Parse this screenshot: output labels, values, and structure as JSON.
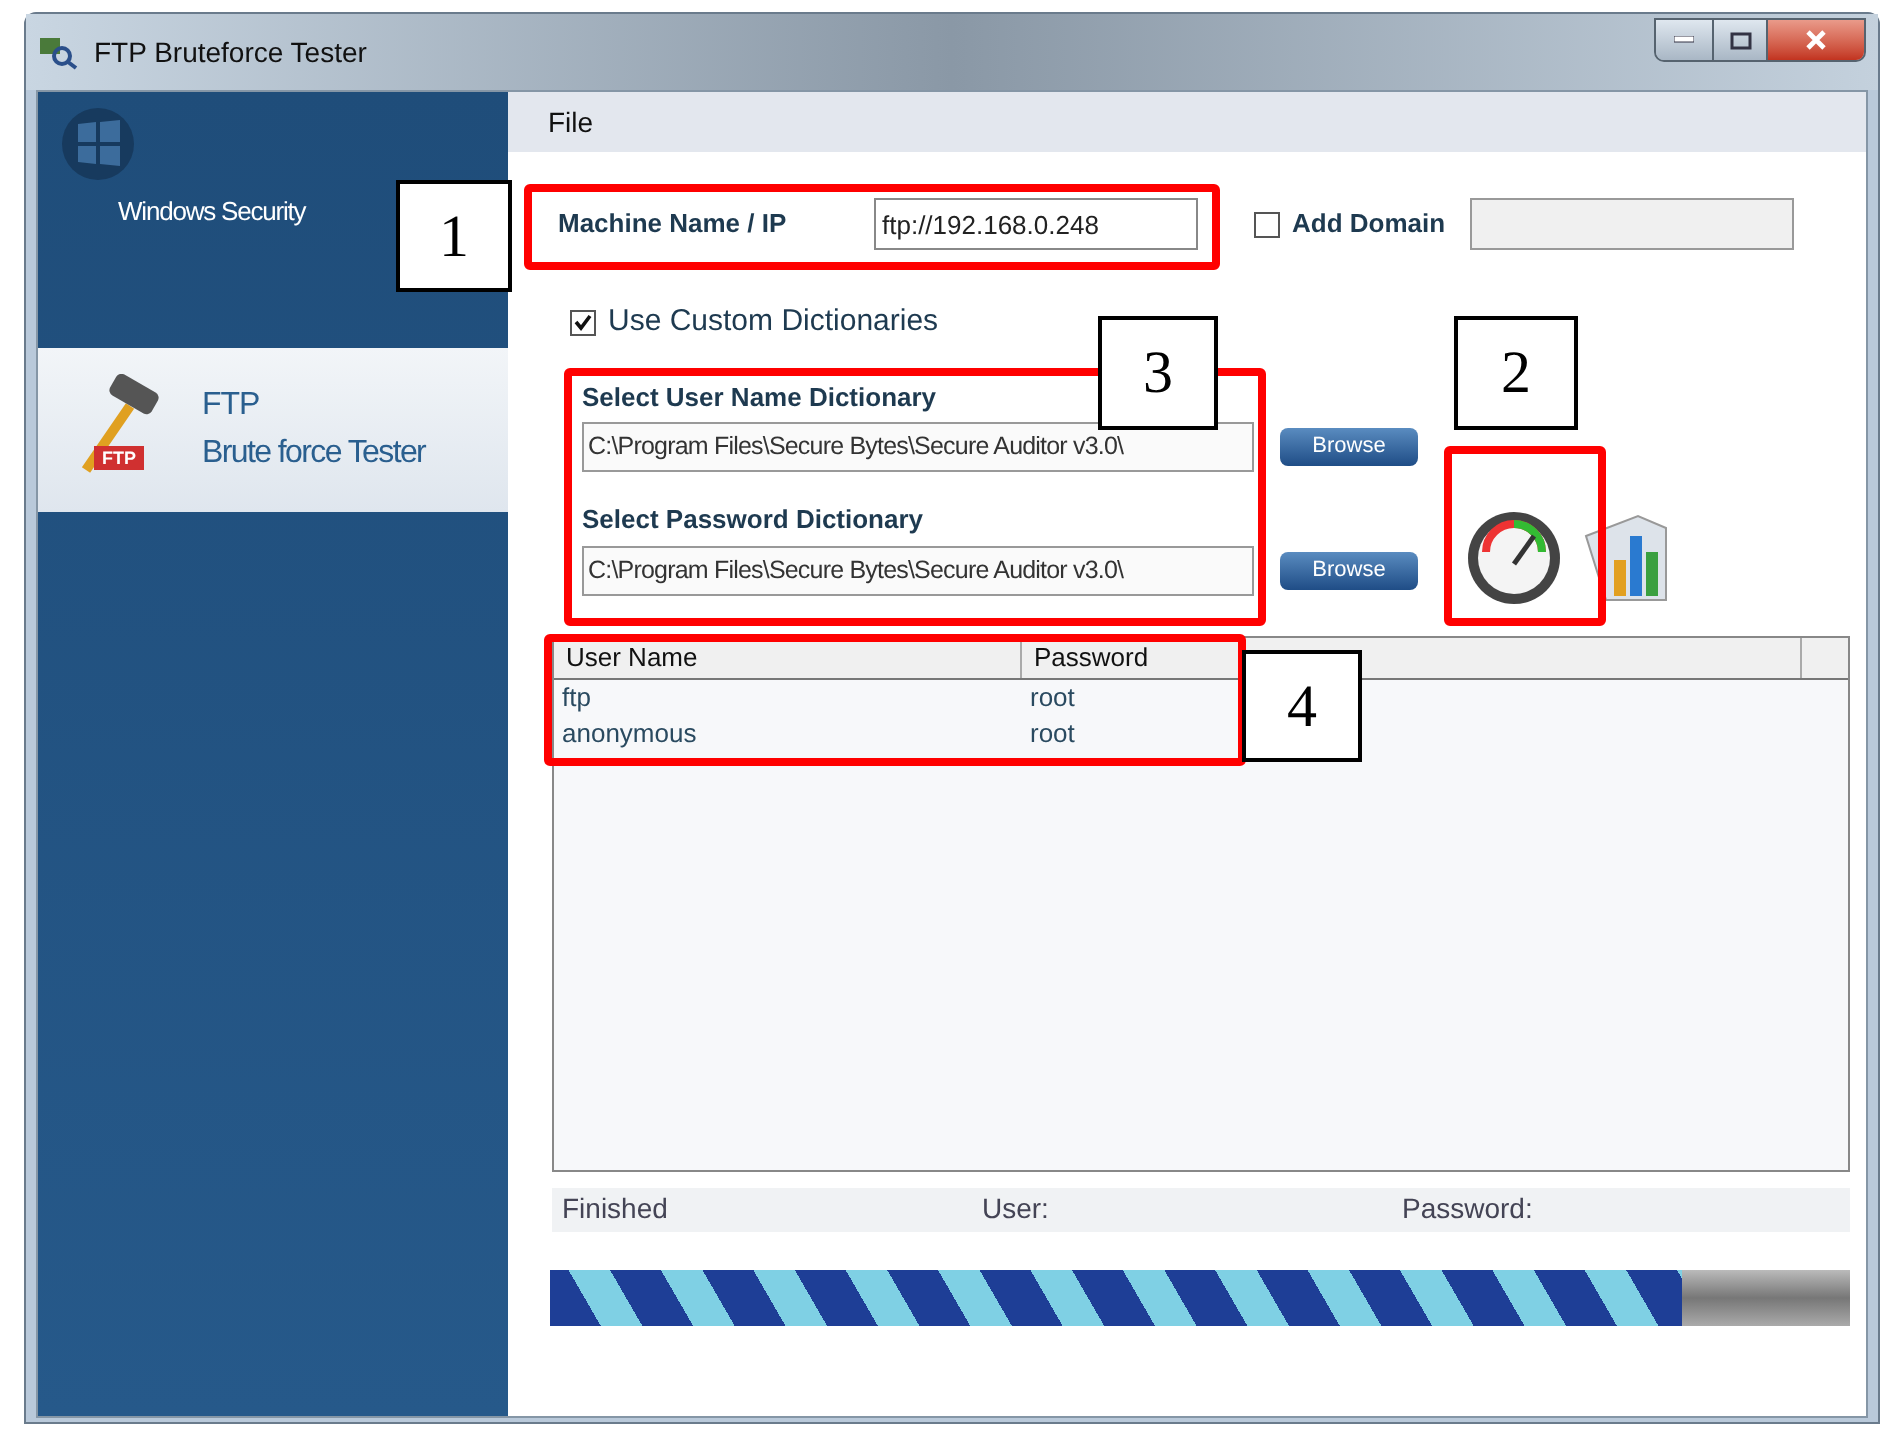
{
  "window": {
    "title": "FTP Bruteforce Tester"
  },
  "sidebar": {
    "brand": "Windows Security",
    "items": [
      {
        "title": "FTP",
        "subtitle": "Brute force Tester",
        "badge": "FTP",
        "selected": true
      }
    ]
  },
  "menu": [
    "File"
  ],
  "machine": {
    "label": "Machine Name / IP",
    "value": "ftp://192.168.0.248"
  },
  "add_domain": {
    "label": "Add Domain",
    "checked": false
  },
  "custom_dictionaries": {
    "label": "Use Custom Dictionaries",
    "checked": true
  },
  "dictionaries": [
    {
      "label": "Select User Name Dictionary",
      "value": "C:\\Program Files\\Secure Bytes\\Secure Auditor v3.0\\",
      "button": "Browse"
    },
    {
      "label": "Select Password Dictionary",
      "value": "C:\\Program Files\\Secure Bytes\\Secure Auditor v3.0\\",
      "button": "Browse"
    }
  ],
  "table": {
    "columns": [
      "User Name",
      "Password"
    ],
    "rows": [
      [
        "ftp",
        "root"
      ],
      [
        "anonymous",
        "root"
      ]
    ]
  },
  "status": [
    "Finished",
    "User:",
    "Password:"
  ],
  "progress": {
    "level": 0.87
  },
  "annotations": [
    {
      "label": "1"
    },
    {
      "label": "2"
    },
    {
      "label": "3"
    },
    {
      "label": "4"
    }
  ]
}
